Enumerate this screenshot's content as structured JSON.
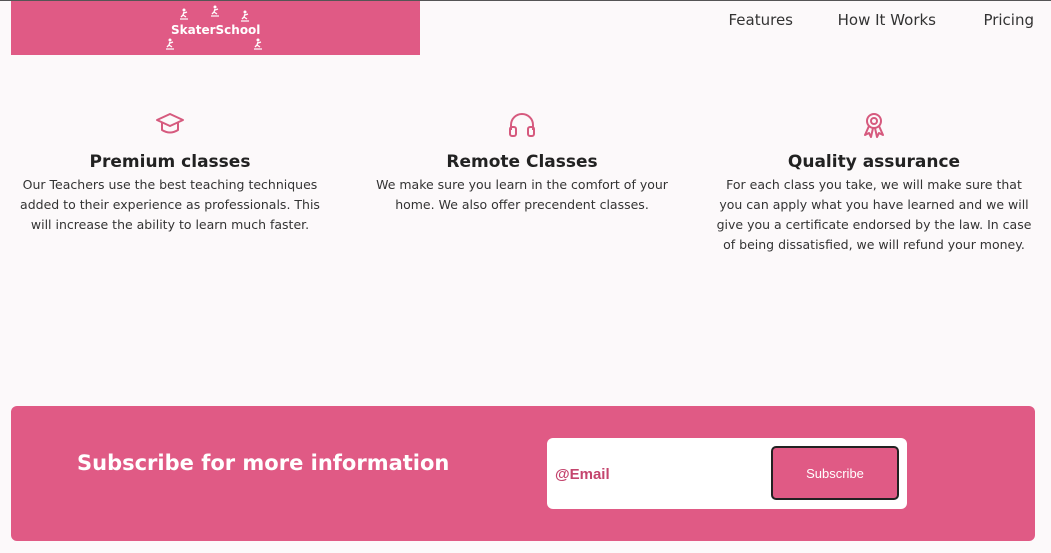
{
  "brand": {
    "name": "SkaterSchool",
    "color": "#e05a85",
    "icon": "skater-icon"
  },
  "nav": {
    "items": [
      "Features",
      "How It Works",
      "Pricing"
    ]
  },
  "features": [
    {
      "icon": "graduation-cap-icon",
      "title": "Premium classes",
      "text": "Our Teachers use the best teaching techniques added to their experience as professionals. This will increase the ability to learn much faster."
    },
    {
      "icon": "headphones-icon",
      "title": "Remote Classes",
      "text": "We make sure you learn in the comfort of your home. We also offer precendent classes."
    },
    {
      "icon": "award-ribbon-icon",
      "title": "Quality assurance",
      "text": "For each class you take, we will make sure that you can apply what you have learned and we will give you a certificate endorsed by the law. In case of being dissatisfied, we will refund your money."
    }
  ],
  "subscribe": {
    "heading": "Subscribe for more information",
    "email_placeholder": "@Email",
    "button_label": "Subscribe"
  },
  "colors": {
    "accent": "#e05a85",
    "background": "#fcf9fa",
    "text": "#222222"
  }
}
